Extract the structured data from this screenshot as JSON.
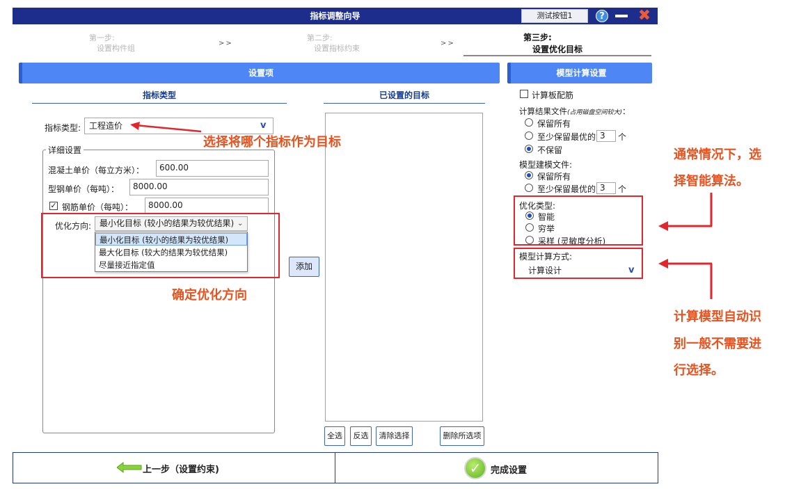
{
  "window": {
    "title": "指标调整向导",
    "test_button": "测试按钮1",
    "help_symbol": "?",
    "close_symbol": "✖",
    "icons": [
      "help-icon",
      "minimize-icon",
      "close-icon"
    ]
  },
  "steps": [
    {
      "line1": "第一步:",
      "line2": "设置构件组"
    },
    {
      "line1": "第二步:",
      "line2": "设置指标约束"
    },
    {
      "line1": "第三步:",
      "line2": "设置优化目标"
    }
  ],
  "step_separator": ">>",
  "left_panel": {
    "header": "设置项",
    "index_type_header": "指标类型",
    "index_type_label": "指标类型:",
    "index_type_value": "工程造价",
    "detail_legend": "详细设置",
    "concrete_label": "混凝土单价（每立方米）：",
    "concrete_value": "600.00",
    "steel_label": "型钢单价（每吨）：",
    "steel_value": "8000.00",
    "rebar_label": "钢筋单价（每吨）：",
    "rebar_value": "8000.00",
    "rebar_checked": true,
    "opt_dir_label": "优化方向:",
    "opt_dir_value": "最小化目标 (较小的结果为较优结果)",
    "opt_dir_options": [
      "最小化目标 (较小的结果为较优结果)",
      "最大化目标 (较大的结果为较优结果)",
      "尽量接近指定值"
    ],
    "add_button": "添加"
  },
  "middle_panel": {
    "header": "已设置的目标",
    "buttons": {
      "select_all": "全选",
      "invert": "反选",
      "clear": "清除选择",
      "delete_all": "删除所选项"
    }
  },
  "right_panel": {
    "header": "模型计算设置",
    "calc_rebar_label": "计算板配筋",
    "calc_rebar_checked": false,
    "result_file_label": "计算结果文件",
    "result_file_note": "(占用磁盘空间较大)",
    "result_file_colon": "：",
    "result_options": {
      "keep_all": "保留所有",
      "keep_best_prefix": "至少保留最优的",
      "keep_best_count": "3",
      "keep_best_suffix": "个",
      "none": "不保留"
    },
    "result_selected": "none",
    "model_file_label": "模型建模文件:",
    "model_options": {
      "keep_all": "保留所有",
      "keep_best_prefix": "至少保留最优的",
      "keep_best_count": "3",
      "keep_best_suffix": "个"
    },
    "model_selected": "keep_all",
    "opt_type_label": "优化类型:",
    "opt_type_options": {
      "smart": "智能",
      "exhaustive": "穷举",
      "sampling": "采样 (灵敏度分析)"
    },
    "opt_type_selected": "smart",
    "calc_method_label": "模型计算方式:",
    "calc_method_value": "计算设计"
  },
  "bottom": {
    "back_label": "上一步（设置约束)",
    "finish_label": "完成设置",
    "check_symbol": "✓"
  },
  "annotations": {
    "index_note": "选择将哪个指标作为目标",
    "direction_note": "确定优化方向",
    "algo_note_line1": "通常情况下，选",
    "algo_note_line2": "择智能算法。",
    "model_note_line1": "计算模型自动识",
    "model_note_line2": "别一般不需要进",
    "model_note_line3": "行选择。"
  },
  "colors": {
    "title_bar": "#1d2d8c",
    "panel_header": "#4f86f5",
    "annotation_red": "#e2262b",
    "annotation_text": "#e8521f"
  }
}
